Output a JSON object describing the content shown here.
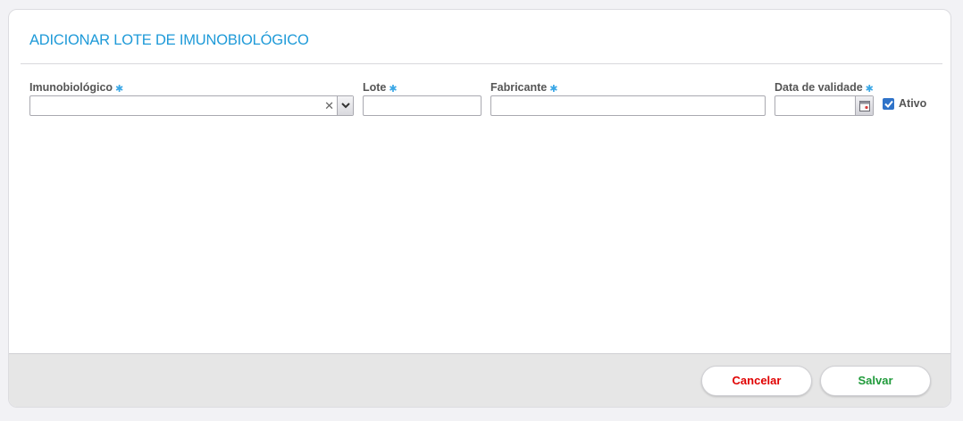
{
  "dialog": {
    "title": "ADICIONAR LOTE DE IMUNOBIOLÓGICO"
  },
  "fields": {
    "imunobiologico": {
      "label": "Imunobiológico",
      "value": ""
    },
    "lote": {
      "label": "Lote",
      "value": ""
    },
    "fabricante": {
      "label": "Fabricante",
      "value": ""
    },
    "data_validade": {
      "label": "Data de validade",
      "value": ""
    },
    "required_marker": "✱"
  },
  "ativo": {
    "label": "Ativo",
    "checked": true
  },
  "footer": {
    "cancel_label": "Cancelar",
    "save_label": "Salvar"
  },
  "colors": {
    "title": "#1e9ad8",
    "cancel": "#e00000",
    "save": "#1f9a3a",
    "required": "#3aa7e6",
    "checkbox": "#2f73c9"
  },
  "icons": {
    "clear": "close-icon",
    "dropdown": "chevron-down-icon",
    "calendar": "calendar-icon",
    "checkbox": "checkmark-icon"
  }
}
